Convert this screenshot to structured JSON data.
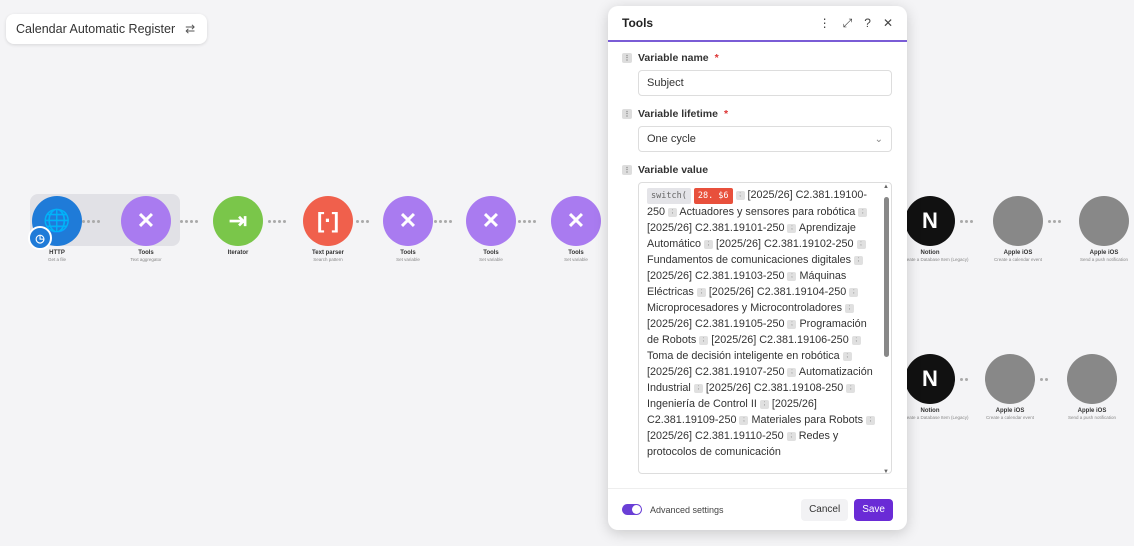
{
  "scenario": {
    "name": "Calendar Automatic Register"
  },
  "nodes": [
    {
      "label": "HTTP",
      "sub": "Get a file",
      "color": "#1f7bd8",
      "icon": "globe-icon"
    },
    {
      "label": "Tools",
      "sub": "Text aggregator",
      "color": "#a97bf0",
      "icon": "tools-icon"
    },
    {
      "label": "Iterator",
      "sub": "",
      "color": "#7ac64a",
      "icon": "iterator-icon"
    },
    {
      "label": "Text parser",
      "sub": "Search pattern",
      "color": "#f0604c",
      "icon": "regex-icon"
    },
    {
      "label": "Tools",
      "sub": "Set variable",
      "color": "#a97bf0",
      "icon": "tools-icon"
    },
    {
      "label": "Tools",
      "sub": "Set variable",
      "color": "#a97bf0",
      "icon": "tools-icon"
    },
    {
      "label": "Tools",
      "sub": "Set variable",
      "color": "#a97bf0",
      "icon": "tools-icon"
    },
    {
      "label": "Notion",
      "sub": "Create a Database Item (Legacy)",
      "color": "#111",
      "icon": "notion-icon"
    },
    {
      "label": "Apple iOS",
      "sub": "Create a calendar event",
      "color": "#888",
      "icon": "apple-icon"
    },
    {
      "label": "Apple iOS",
      "sub": "Send a push notification",
      "color": "#888",
      "icon": "apple-icon"
    },
    {
      "label": "Notion",
      "sub": "Create a Database Item (Legacy)",
      "color": "#111",
      "icon": "notion-icon"
    },
    {
      "label": "Apple iOS",
      "sub": "Create a calendar event",
      "color": "#888",
      "icon": "apple-icon"
    },
    {
      "label": "Apple iOS",
      "sub": "Send a push notification",
      "color": "#888",
      "icon": "apple-icon"
    }
  ],
  "panel": {
    "title": "Tools",
    "variable_name_label": "Variable name",
    "variable_name_value": "Subject",
    "variable_lifetime_label": "Variable lifetime",
    "variable_lifetime_value": "One cycle",
    "variable_value_label": "Variable value",
    "fn_name": "switch(",
    "fn_arg": "28. $6",
    "value_segments": [
      "[2025/26] C2.381.19100-250",
      "Actuadores y sensores para robótica",
      "[2025/26] C2.381.19101-250",
      "Aprendizaje Automático",
      "[2025/26] C2.381.19102-250",
      "Fundamentos de comunicaciones digitales",
      "[2025/26] C2.381.19103-250",
      "Máquinas Eléctricas",
      "[2025/26] C2.381.19104-250",
      "Microprocesadores y Microcontroladores",
      "[2025/26] C2.381.19105-250",
      "Programación de Robots",
      "[2025/26] C2.381.19106-250",
      "Toma de decisión inteligente en robótica",
      "[2025/26] C2.381.19107-250",
      "Automatización Industrial",
      "[2025/26] C2.381.19108-250",
      "Ingeniería de Control II",
      "[2025/26] C2.381.19109-250",
      "Materiales para Robots",
      "[2025/26] C2.381.19110-250",
      "Redes y protocolos de comunicación"
    ],
    "advanced_label": "Advanced settings",
    "cancel_label": "Cancel",
    "save_label": "Save"
  }
}
